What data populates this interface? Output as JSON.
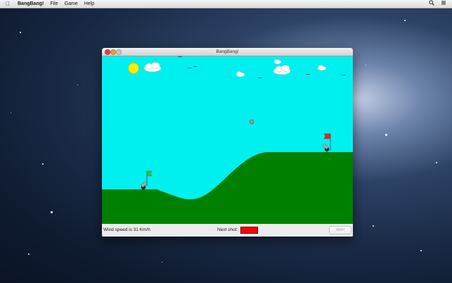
{
  "menubar": {
    "apple_icon": "apple-logo-icon",
    "app_name": "BangBang!",
    "items": [
      "File",
      "Game",
      "Help"
    ],
    "right_icons": [
      "search-icon",
      "list-icon"
    ]
  },
  "window": {
    "title": "BangBang!"
  },
  "game": {
    "sky_color": "#00f0f0",
    "ground_color": "#008000",
    "sun_color": "#ffec00",
    "player_flag_color": "#35c035",
    "enemy_flag_color": "#ee2222",
    "projectile": "cannonball"
  },
  "status": {
    "wind_text": "Wind speed is 31 Km/h",
    "next_shot_label": "Next shot:",
    "next_shot_color": "#ff0000",
    "aim_label": "Aim!"
  }
}
